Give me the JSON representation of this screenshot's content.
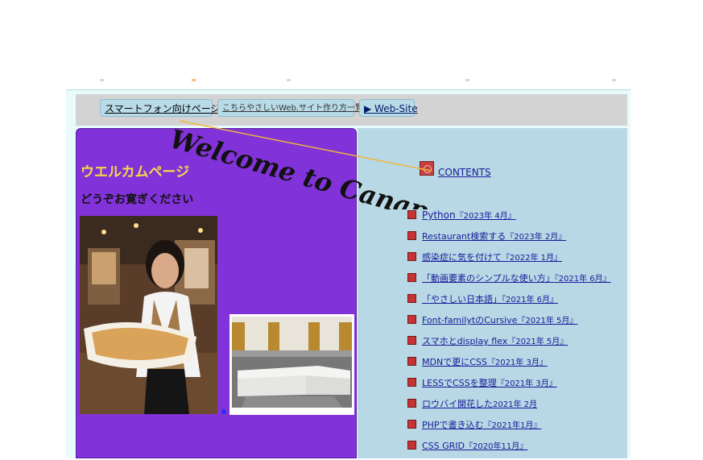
{
  "navbar": {
    "smartphone_label": "スマートフォン向けページ",
    "guide_label": "こちらやさしいWeb.サイト作り方一覧",
    "website_label": "▶ Web-Site"
  },
  "banner": {
    "text": "Welcome to Canape",
    "line_color": "#f0b73a"
  },
  "left": {
    "title": "ウエルカムページ",
    "subtitle": "どうぞお寛ぎください",
    "diamond": "♦",
    "background": "#8132d8"
  },
  "right": {
    "contents_label": "CONTENTS",
    "background": "#b7d8e4",
    "articles": [
      {
        "title": "Python",
        "date": "『2023年 4月』"
      },
      {
        "title": "Restaurant検索する",
        "date": "『2023年 2月』"
      },
      {
        "title": "感染症に気を付けて",
        "date": "『2022年 1月』"
      },
      {
        "title": "「動画要素のシンプルな使い方」",
        "date": "『2021年 6月』"
      },
      {
        "title": "「やさしい日本語」",
        "date": "『2021年 6月』"
      },
      {
        "title": "Font-familytのCursive",
        "date": "『2021年 5月』"
      },
      {
        "title": "スマホとdisplay flex",
        "date": "『2021年 5月』"
      },
      {
        "title": "MDNで更にCSS",
        "date": "『2021年 3月』"
      },
      {
        "title": "LESSでCSSを整理",
        "date": "『2021年 3月』"
      },
      {
        "title": "ロウバイ開花した",
        "date": "2021年 2月"
      },
      {
        "title": "PHPで書き込む",
        "date": "『2021年1月』"
      },
      {
        "title": " CSS GRID",
        "date": "『2020年11月』"
      }
    ]
  }
}
